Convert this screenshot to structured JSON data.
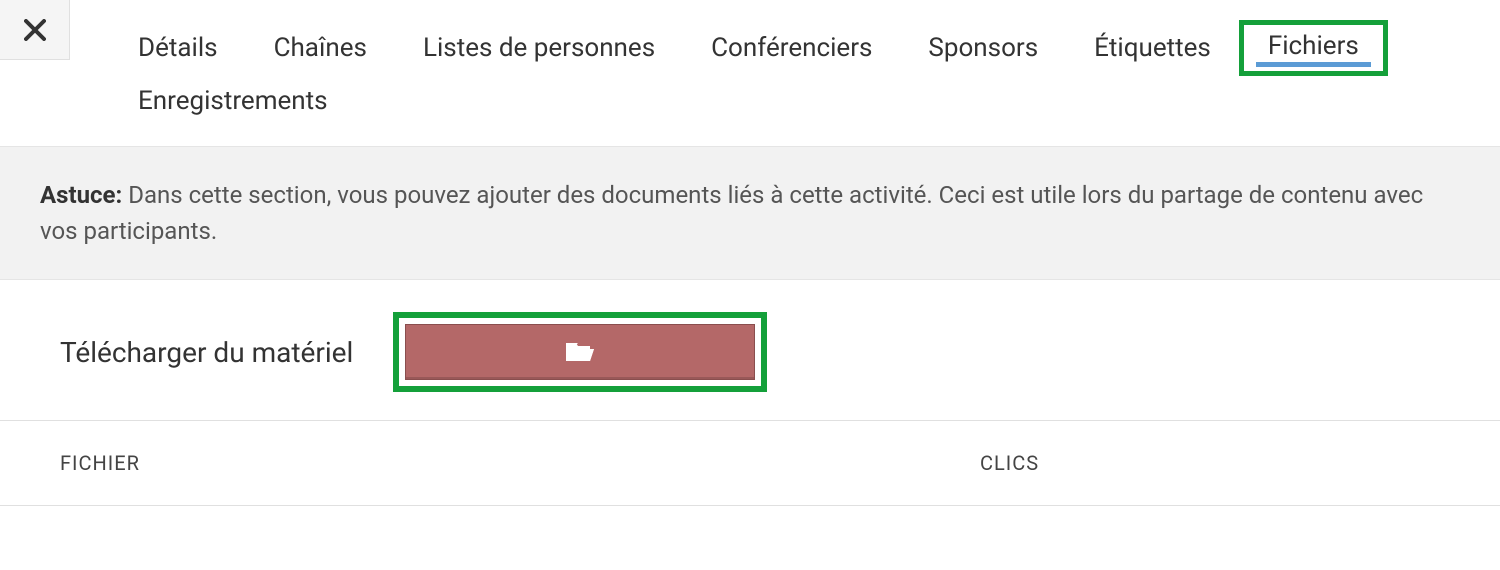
{
  "tabs": [
    {
      "label": "Détails"
    },
    {
      "label": "Chaînes"
    },
    {
      "label": "Listes de personnes"
    },
    {
      "label": "Conférenciers"
    },
    {
      "label": "Sponsors"
    },
    {
      "label": "Étiquettes"
    },
    {
      "label": "Fichiers",
      "active": true
    },
    {
      "label": "Enregistrements"
    }
  ],
  "tip": {
    "prefix": "Astuce:",
    "text": " Dans cette section, vous pouvez ajouter des documents liés à cette activité. Ceci est utile lors du partage de contenu avec vos participants."
  },
  "upload": {
    "label": "Télécharger du matériel"
  },
  "table": {
    "col_file": "FICHIER",
    "col_clicks": "CLICS"
  }
}
